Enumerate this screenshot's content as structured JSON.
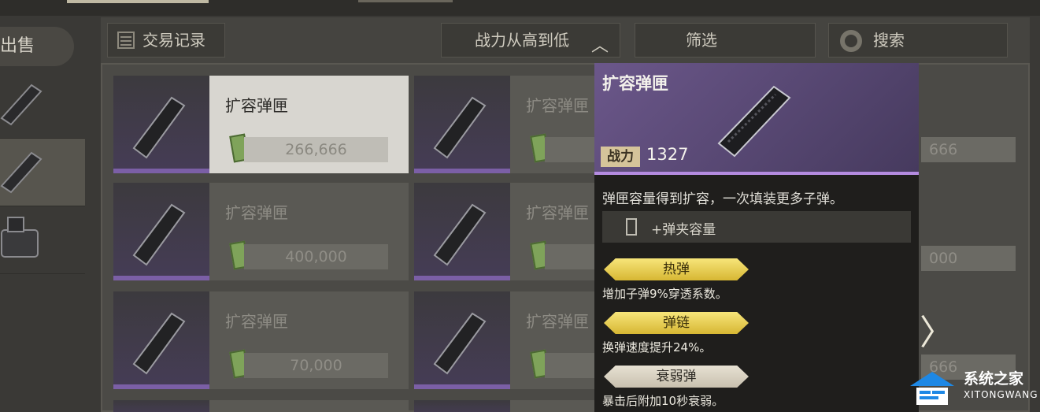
{
  "sidebar": {
    "sell_label": "出售"
  },
  "toolbar": {
    "trade_record": "交易记录",
    "sort_label": "战力从高到低",
    "sort_chevron": "︿",
    "filter_label": "筛选",
    "search_label": "搜索"
  },
  "items": [
    {
      "name": "扩容弹匣",
      "price": "266,666"
    },
    {
      "name": "扩容弹匣",
      "price": ""
    },
    {
      "name": "扩容弹匣",
      "price": "400,000"
    },
    {
      "name": "扩容弹匣",
      "price": ""
    },
    {
      "name": "扩容弹匣",
      "price": "70,000"
    },
    {
      "name": "扩容弹匣",
      "price": ""
    }
  ],
  "partial_prices": {
    "row1": "666",
    "row2": "000",
    "row3": "666"
  },
  "next_arrow": "〉",
  "tooltip": {
    "title": "扩容弹匣",
    "power_label": "战力",
    "power_value": "1327",
    "description": "弹匣容量得到扩容，一次填装更多子弹。",
    "stat": "+弹夹容量",
    "perks": [
      {
        "name": "热弹",
        "desc": "增加子弹9%穿透系数。",
        "tier": "gold"
      },
      {
        "name": "弹链",
        "desc": "换弹速度提升24%。",
        "tier": "gold"
      },
      {
        "name": "衰弱弹",
        "desc": "暴击后附加10秒衰弱。",
        "tier": "grey"
      }
    ]
  },
  "watermark": {
    "cn": "系统之家",
    "en": "XITONGWANG"
  },
  "colors": {
    "rarity_purple": "#7b5fa6",
    "perk_gold": "#e8cf55",
    "accent_lavender": "#b48be0"
  }
}
